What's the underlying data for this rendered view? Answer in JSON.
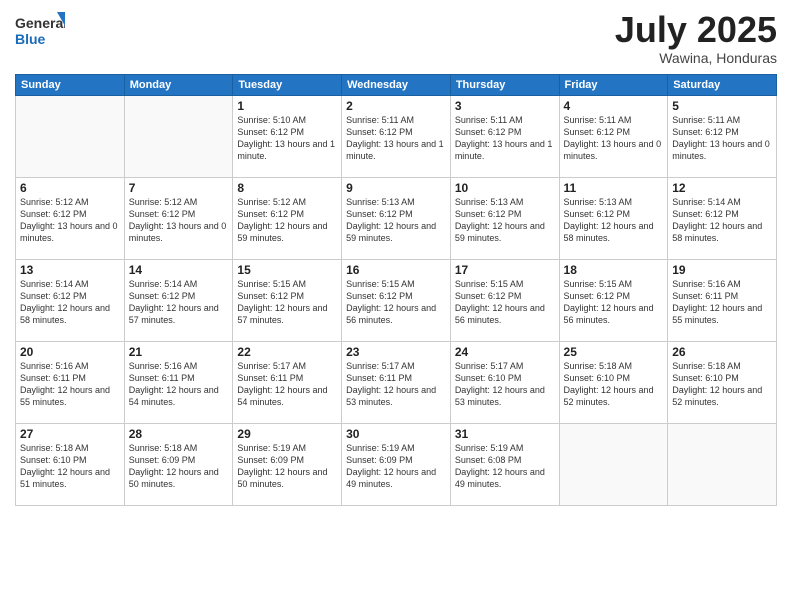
{
  "logo": {
    "general": "General",
    "blue": "Blue"
  },
  "title": "July 2025",
  "location": "Wawina, Honduras",
  "days_of_week": [
    "Sunday",
    "Monday",
    "Tuesday",
    "Wednesday",
    "Thursday",
    "Friday",
    "Saturday"
  ],
  "weeks": [
    [
      {
        "day": "",
        "info": ""
      },
      {
        "day": "",
        "info": ""
      },
      {
        "day": "1",
        "info": "Sunrise: 5:10 AM\nSunset: 6:12 PM\nDaylight: 13 hours and 1 minute."
      },
      {
        "day": "2",
        "info": "Sunrise: 5:11 AM\nSunset: 6:12 PM\nDaylight: 13 hours and 1 minute."
      },
      {
        "day": "3",
        "info": "Sunrise: 5:11 AM\nSunset: 6:12 PM\nDaylight: 13 hours and 1 minute."
      },
      {
        "day": "4",
        "info": "Sunrise: 5:11 AM\nSunset: 6:12 PM\nDaylight: 13 hours and 0 minutes."
      },
      {
        "day": "5",
        "info": "Sunrise: 5:11 AM\nSunset: 6:12 PM\nDaylight: 13 hours and 0 minutes."
      }
    ],
    [
      {
        "day": "6",
        "info": "Sunrise: 5:12 AM\nSunset: 6:12 PM\nDaylight: 13 hours and 0 minutes."
      },
      {
        "day": "7",
        "info": "Sunrise: 5:12 AM\nSunset: 6:12 PM\nDaylight: 13 hours and 0 minutes."
      },
      {
        "day": "8",
        "info": "Sunrise: 5:12 AM\nSunset: 6:12 PM\nDaylight: 12 hours and 59 minutes."
      },
      {
        "day": "9",
        "info": "Sunrise: 5:13 AM\nSunset: 6:12 PM\nDaylight: 12 hours and 59 minutes."
      },
      {
        "day": "10",
        "info": "Sunrise: 5:13 AM\nSunset: 6:12 PM\nDaylight: 12 hours and 59 minutes."
      },
      {
        "day": "11",
        "info": "Sunrise: 5:13 AM\nSunset: 6:12 PM\nDaylight: 12 hours and 58 minutes."
      },
      {
        "day": "12",
        "info": "Sunrise: 5:14 AM\nSunset: 6:12 PM\nDaylight: 12 hours and 58 minutes."
      }
    ],
    [
      {
        "day": "13",
        "info": "Sunrise: 5:14 AM\nSunset: 6:12 PM\nDaylight: 12 hours and 58 minutes."
      },
      {
        "day": "14",
        "info": "Sunrise: 5:14 AM\nSunset: 6:12 PM\nDaylight: 12 hours and 57 minutes."
      },
      {
        "day": "15",
        "info": "Sunrise: 5:15 AM\nSunset: 6:12 PM\nDaylight: 12 hours and 57 minutes."
      },
      {
        "day": "16",
        "info": "Sunrise: 5:15 AM\nSunset: 6:12 PM\nDaylight: 12 hours and 56 minutes."
      },
      {
        "day": "17",
        "info": "Sunrise: 5:15 AM\nSunset: 6:12 PM\nDaylight: 12 hours and 56 minutes."
      },
      {
        "day": "18",
        "info": "Sunrise: 5:15 AM\nSunset: 6:12 PM\nDaylight: 12 hours and 56 minutes."
      },
      {
        "day": "19",
        "info": "Sunrise: 5:16 AM\nSunset: 6:11 PM\nDaylight: 12 hours and 55 minutes."
      }
    ],
    [
      {
        "day": "20",
        "info": "Sunrise: 5:16 AM\nSunset: 6:11 PM\nDaylight: 12 hours and 55 minutes."
      },
      {
        "day": "21",
        "info": "Sunrise: 5:16 AM\nSunset: 6:11 PM\nDaylight: 12 hours and 54 minutes."
      },
      {
        "day": "22",
        "info": "Sunrise: 5:17 AM\nSunset: 6:11 PM\nDaylight: 12 hours and 54 minutes."
      },
      {
        "day": "23",
        "info": "Sunrise: 5:17 AM\nSunset: 6:11 PM\nDaylight: 12 hours and 53 minutes."
      },
      {
        "day": "24",
        "info": "Sunrise: 5:17 AM\nSunset: 6:10 PM\nDaylight: 12 hours and 53 minutes."
      },
      {
        "day": "25",
        "info": "Sunrise: 5:18 AM\nSunset: 6:10 PM\nDaylight: 12 hours and 52 minutes."
      },
      {
        "day": "26",
        "info": "Sunrise: 5:18 AM\nSunset: 6:10 PM\nDaylight: 12 hours and 52 minutes."
      }
    ],
    [
      {
        "day": "27",
        "info": "Sunrise: 5:18 AM\nSunset: 6:10 PM\nDaylight: 12 hours and 51 minutes."
      },
      {
        "day": "28",
        "info": "Sunrise: 5:18 AM\nSunset: 6:09 PM\nDaylight: 12 hours and 50 minutes."
      },
      {
        "day": "29",
        "info": "Sunrise: 5:19 AM\nSunset: 6:09 PM\nDaylight: 12 hours and 50 minutes."
      },
      {
        "day": "30",
        "info": "Sunrise: 5:19 AM\nSunset: 6:09 PM\nDaylight: 12 hours and 49 minutes."
      },
      {
        "day": "31",
        "info": "Sunrise: 5:19 AM\nSunset: 6:08 PM\nDaylight: 12 hours and 49 minutes."
      },
      {
        "day": "",
        "info": ""
      },
      {
        "day": "",
        "info": ""
      }
    ]
  ]
}
